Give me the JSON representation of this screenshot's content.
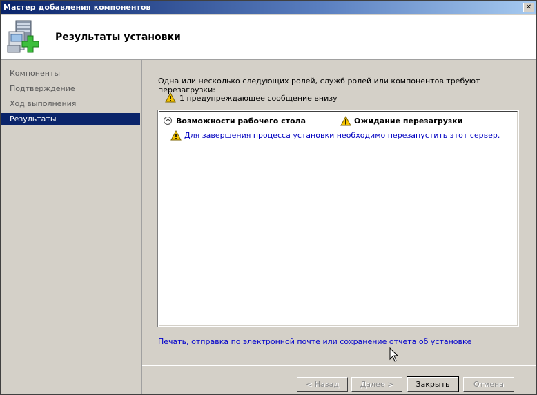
{
  "window": {
    "title": "Мастер добавления компонентов",
    "close_label": "✕"
  },
  "header": {
    "title": "Результаты установки",
    "icon": "server-add-icon"
  },
  "sidebar": {
    "items": [
      {
        "label": "Компоненты",
        "active": false
      },
      {
        "label": "Подтверждение",
        "active": false
      },
      {
        "label": "Ход выполнения",
        "active": false
      },
      {
        "label": "Результаты",
        "active": true
      }
    ]
  },
  "main": {
    "intro": "Одна или несколько следующих ролей, служб ролей или компонентов требуют перезагрузки:",
    "warning_summary": "1 предупреждающее сообщение внизу",
    "results": {
      "component": "Возможности рабочего стола",
      "status": "Ожидание перезагрузки",
      "detail": "Для завершения процесса установки необходимо перезапустить этот сервер."
    },
    "report_link": "Печать, отправка по электронной почте или сохранение отчета об установке"
  },
  "buttons": {
    "back": "< Назад",
    "next": "Далее >",
    "close": "Закрыть",
    "cancel": "Отмена"
  },
  "colors": {
    "selection": "#0a246a",
    "link": "#0000cc",
    "detail_text": "#0000c0",
    "warning": "#f5c400"
  }
}
